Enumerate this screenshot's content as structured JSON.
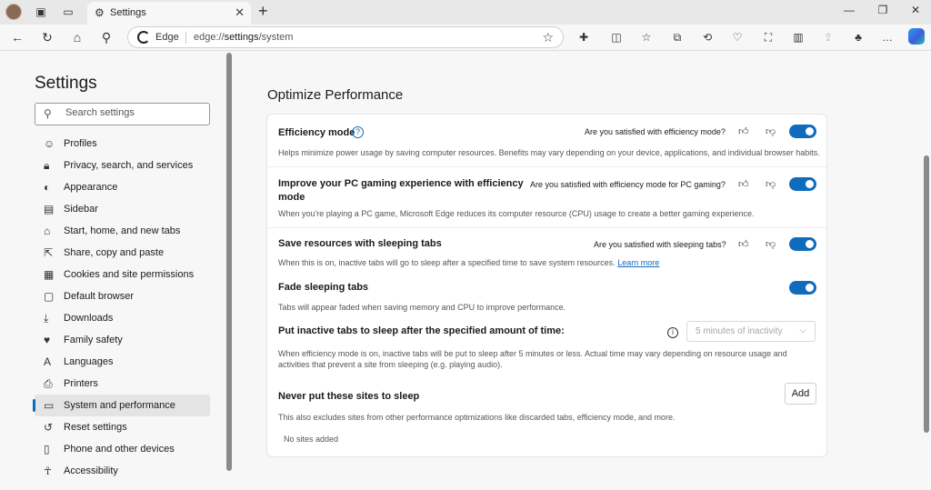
{
  "browser": {
    "tab_title": "Settings",
    "address_brand": "Edge",
    "address_url_prefix": "edge://",
    "address_url_path": "settings",
    "address_url_suffix": "/system"
  },
  "sidebar": {
    "title": "Settings",
    "search_placeholder": "Search settings",
    "items": [
      {
        "label": "Profiles",
        "icon": "profile-icon"
      },
      {
        "label": "Privacy, search, and services",
        "icon": "lock-icon"
      },
      {
        "label": "Appearance",
        "icon": "appearance-icon"
      },
      {
        "label": "Sidebar",
        "icon": "sidebar-icon"
      },
      {
        "label": "Start, home, and new tabs",
        "icon": "home-icon"
      },
      {
        "label": "Share, copy and paste",
        "icon": "share-icon"
      },
      {
        "label": "Cookies and site permissions",
        "icon": "cookies-icon"
      },
      {
        "label": "Default browser",
        "icon": "browser-icon"
      },
      {
        "label": "Downloads",
        "icon": "download-icon"
      },
      {
        "label": "Family safety",
        "icon": "family-icon"
      },
      {
        "label": "Languages",
        "icon": "language-icon"
      },
      {
        "label": "Printers",
        "icon": "printer-icon"
      },
      {
        "label": "System and performance",
        "icon": "system-icon",
        "active": true
      },
      {
        "label": "Reset settings",
        "icon": "reset-icon"
      },
      {
        "label": "Phone and other devices",
        "icon": "phone-icon"
      },
      {
        "label": "Accessibility",
        "icon": "accessibility-icon"
      }
    ]
  },
  "main": {
    "section_title": "Optimize Performance",
    "efficiency": {
      "title": "Efficiency mode",
      "question": "Are you satisfied with efficiency mode?",
      "desc": "Helps minimize power usage by saving computer resources. Benefits may vary depending on your device, applications, and individual browser habits.",
      "enabled": true
    },
    "gaming": {
      "title_line1": "Improve your PC gaming experience with efficiency",
      "title_line2": "mode",
      "question": "Are you satisfied with efficiency mode for PC gaming?",
      "desc": "When you're playing a PC game, Microsoft Edge reduces its computer resource (CPU) usage to create a better gaming experience.",
      "enabled": true
    },
    "sleeping": {
      "title": "Save resources with sleeping tabs",
      "question": "Are you satisfied with sleeping tabs?",
      "desc": "When this is on, inactive tabs will go to sleep after a specified time to save system resources.",
      "link": "Learn more",
      "enabled": true
    },
    "fade": {
      "title": "Fade sleeping tabs",
      "desc": "Tabs will appear faded when saving memory and CPU to improve performance.",
      "enabled": true
    },
    "inactive": {
      "title": "Put inactive tabs to sleep after the specified amount of time:",
      "dropdown_value": "5 minutes of inactivity",
      "desc_line1": "When efficiency mode is on, inactive tabs will be put to sleep after 5 minutes or less. Actual time may vary depending on resource usage and",
      "desc_line2": "activities that prevent a site from sleeping (e.g. playing audio)."
    },
    "never_sleep": {
      "title": "Never put these sites to sleep",
      "add_label": "Add",
      "desc": "This also excludes sites from other performance optimizations like discarded tabs, efficiency mode, and more.",
      "empty": "No sites added"
    }
  },
  "colors": {
    "accent": "#0f6cbd"
  }
}
